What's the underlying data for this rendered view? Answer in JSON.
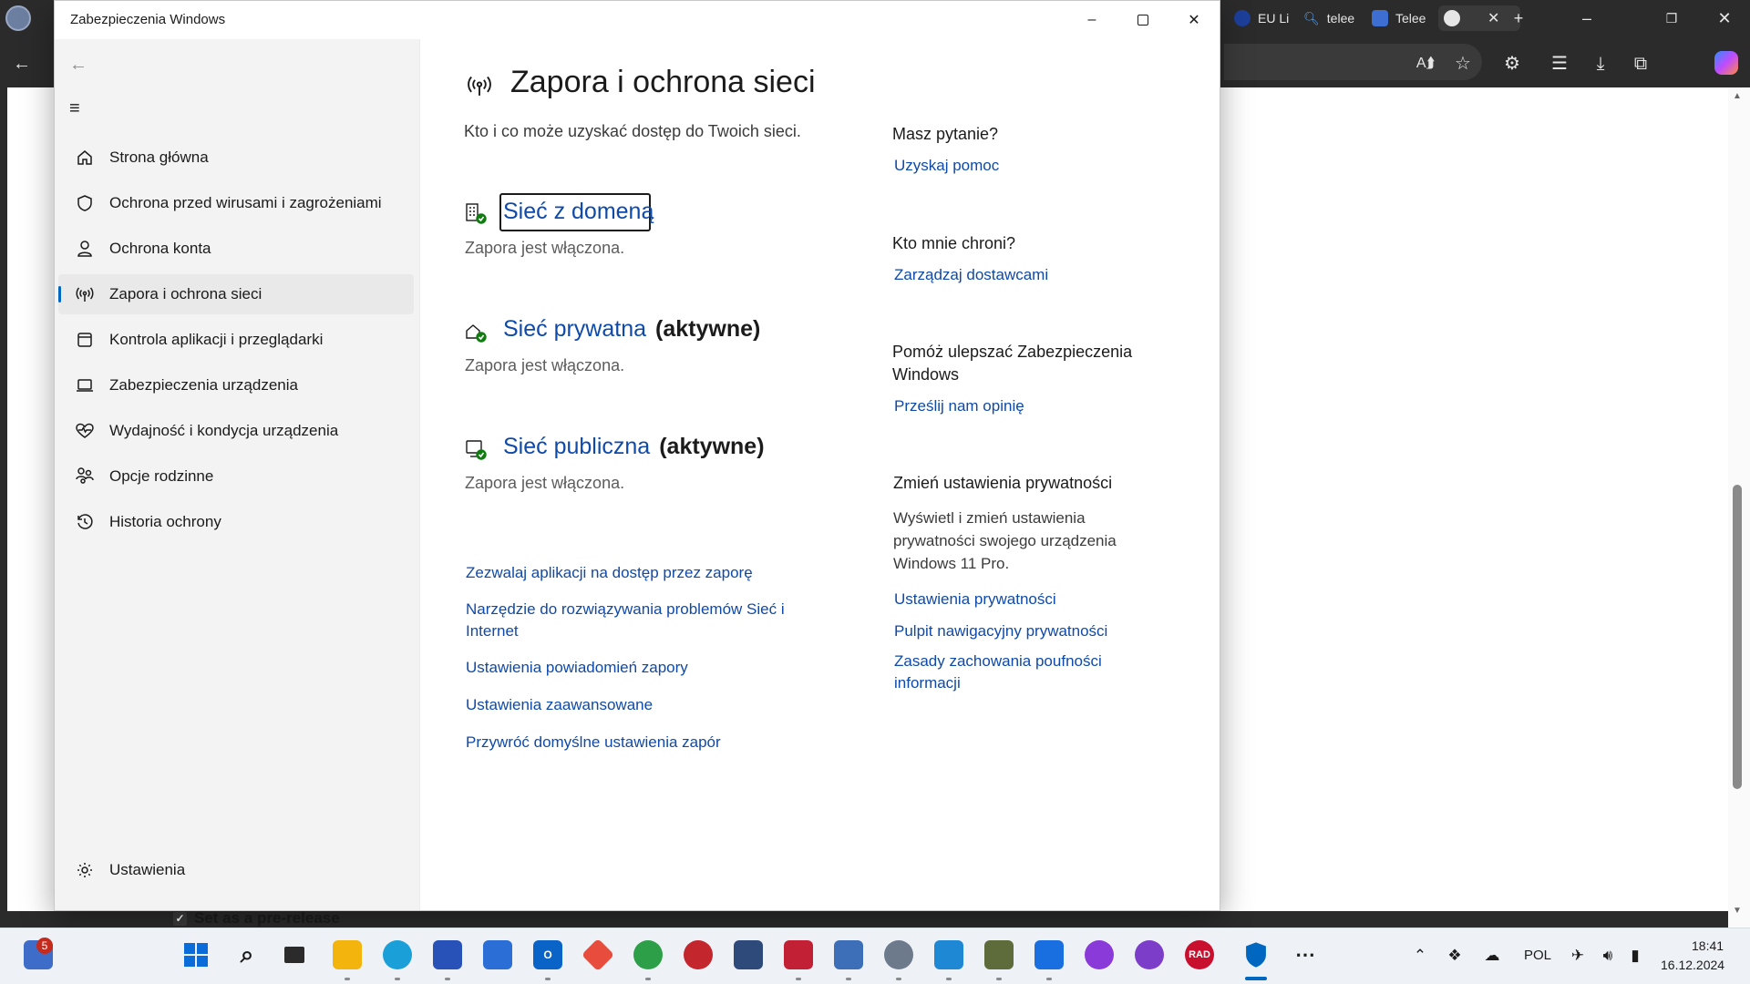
{
  "window": {
    "title": "Zabezpieczenia Windows"
  },
  "nav": {
    "items": [
      {
        "label": "Strona główna",
        "icon": "home-icon"
      },
      {
        "label": "Ochrona przed wirusami i zagrożeniami",
        "icon": "shield-icon"
      },
      {
        "label": "Ochrona konta",
        "icon": "person-icon"
      },
      {
        "label": "Zapora i ochrona sieci",
        "icon": "antenna-icon",
        "active": true
      },
      {
        "label": "Kontrola aplikacji i przeglądarki",
        "icon": "app-browser-icon"
      },
      {
        "label": "Zabezpieczenia urządzenia",
        "icon": "laptop-icon"
      },
      {
        "label": "Wydajność i kondycja urządzenia",
        "icon": "heart-pulse-icon"
      },
      {
        "label": "Opcje rodzinne",
        "icon": "family-icon"
      },
      {
        "label": "Historia ochrony",
        "icon": "history-icon"
      }
    ],
    "settings": "Ustawienia"
  },
  "page": {
    "title": "Zapora i ochrona sieci",
    "subtitle": "Kto i co może uzyskać dostęp do Twoich sieci."
  },
  "networks": [
    {
      "name": "Sieć z domeną",
      "active_label": "",
      "status": "Zapora jest włączona."
    },
    {
      "name": "Sieć prywatna",
      "active_label": "(aktywne)",
      "status": "Zapora jest włączona."
    },
    {
      "name": "Sieć publiczna",
      "active_label": "(aktywne)",
      "status": "Zapora jest włączona."
    }
  ],
  "links": [
    "Zezwalaj aplikacji na dostęp przez zaporę",
    "Narzędzie do rozwiązywania problemów Sieć i Internet",
    "Ustawienia powiadomień zapory",
    "Ustawienia zaawansowane",
    "Przywróć domyślne ustawienia zapór"
  ],
  "side": {
    "question": {
      "heading": "Masz pytanie?",
      "link": "Uzyskaj pomoc"
    },
    "protect": {
      "heading": "Kto mnie chroni?",
      "link": "Zarządzaj dostawcami"
    },
    "improve": {
      "heading": "Pomóż ulepszać Zabezpieczenia Windows",
      "link": "Prześlij nam opinię"
    },
    "privacy": {
      "heading": "Zmień ustawienia prywatności",
      "text": "Wyświetl i zmień ustawienia prywatności swojego urządzenia Windows 11 Pro.",
      "links": [
        "Ustawienia prywatności",
        "Pulpit nawigacyjny prywatności",
        "Zasady zachowania poufności informacji"
      ]
    }
  },
  "browser": {
    "tabs": [
      "EU Li",
      "telee",
      "Telee"
    ],
    "prerelease_label": "Set as a pre-release"
  },
  "taskbar": {
    "notification_count": "5",
    "language": "POL",
    "time": "18:41",
    "date": "16.12.2024",
    "rad_label": "RAD"
  },
  "colors": {
    "accent": "#0067c0",
    "link": "#0f4aa8",
    "firewall_ok": "#107c10"
  }
}
